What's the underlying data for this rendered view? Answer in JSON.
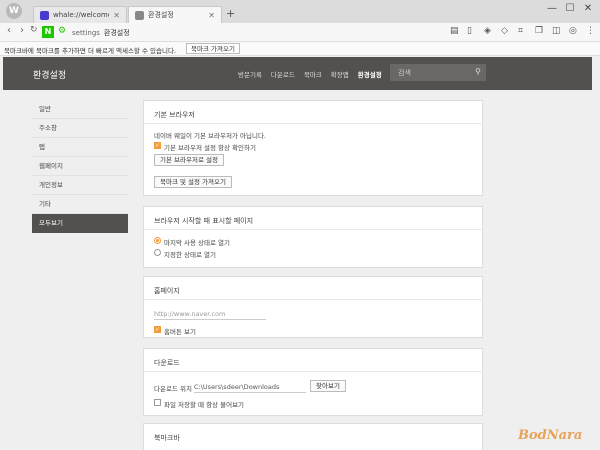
{
  "window": {
    "tabs": [
      {
        "label": "whale://welcome",
        "favicon_color": "#4b3ad0"
      },
      {
        "label": "환경설정",
        "favicon_color": "#888888"
      }
    ],
    "new_tab_symbol": "+",
    "controls": {
      "minimize": "—",
      "maximize": "☐",
      "close": "✕"
    }
  },
  "address_bar": {
    "scheme": "settings",
    "title": "환경설정"
  },
  "bookmark_notice": {
    "text": "북마크바에 북마크를 추가하면 더 빠르게 액세스할 수 있습니다.",
    "button": "북마크 가져오기"
  },
  "header": {
    "title": "환경설정",
    "menu": [
      "방문기록",
      "다운로드",
      "북마크",
      "확장앱",
      "환경설정"
    ],
    "active_menu": "환경설정",
    "search_placeholder": "검색"
  },
  "sidebar": {
    "items": [
      {
        "label": "일반",
        "active": false
      },
      {
        "label": "주소창",
        "active": false
      },
      {
        "label": "탭",
        "active": false
      },
      {
        "label": "웹페이지",
        "active": false
      },
      {
        "label": "개인정보",
        "active": false
      },
      {
        "label": "기타",
        "active": false
      },
      {
        "label": "모두보기",
        "active": true
      }
    ]
  },
  "default_browser": {
    "title": "기본 브라우저",
    "status": "네이버 웨일이 기본 브라우저가 아닙니다.",
    "check_label": "기본 브라우저 설정 항상 확인하기",
    "check_value": true,
    "set_default_button": "기본 브라우저로 설정",
    "import_button": "북마크 및 설정 가져오기"
  },
  "startup": {
    "title": "브라우저 시작할 때 표시할 페이지",
    "options": [
      "마지막 사용 상태로 열기",
      "지정한 상태로 열기"
    ],
    "selected": "마지막 사용 상태로 열기"
  },
  "homepage": {
    "title": "홈페이지",
    "url_placeholder": "http://www.naver.com",
    "check_label": "홈버튼 보기",
    "check_value": true
  },
  "download": {
    "title": "다운로드",
    "location_label": "다운로드 위치",
    "location_value": "C:\\Users\\sdeer\\Downloads",
    "browse_button": "찾아보기",
    "ask_label": "파일 저장할 때 항상 물어보기",
    "ask_value": false
  },
  "bookmarkbar": {
    "title": "북마크바"
  },
  "watermark": "BodNara"
}
